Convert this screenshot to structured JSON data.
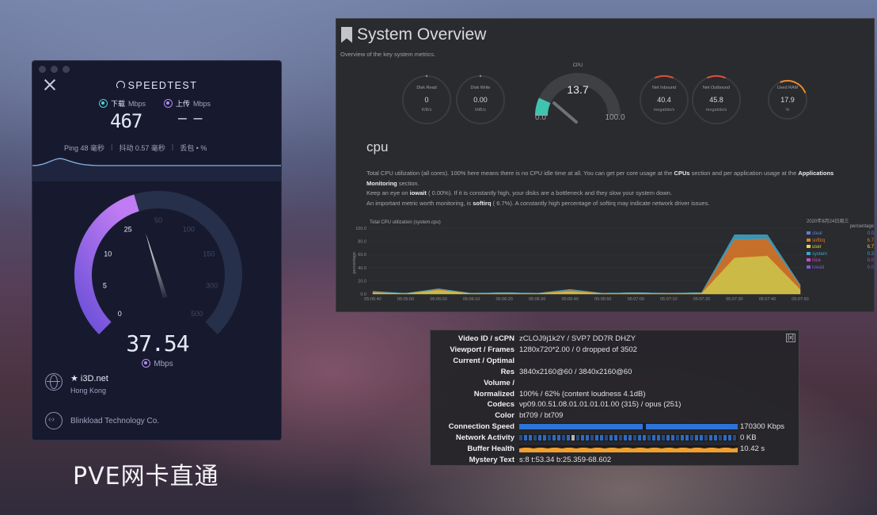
{
  "speedtest": {
    "title": "SPEEDTEST",
    "download": {
      "label": "下载",
      "unit": "Mbps",
      "value": "467"
    },
    "upload": {
      "label": "上传",
      "unit": "Mbps",
      "value": "– –"
    },
    "metrics": {
      "ping": "Ping 48 毫秒",
      "jitter": "抖动 0.57 毫秒",
      "loss": "丢包 • %"
    },
    "gauge": {
      "ticks": [
        "0",
        "5",
        "10",
        "25",
        "50",
        "100",
        "150",
        "300",
        "500"
      ],
      "current_value": "37.54",
      "unit": "Mbps",
      "arc_color": "#9c63e8"
    },
    "host": {
      "name": "★ i3D.net",
      "location": "Hong Kong"
    },
    "isp": "Blinkload Technology Co."
  },
  "caption": "PVE网卡直通",
  "system_overview": {
    "title": "System Overview",
    "subtitle": "Overview of the key system metrics.",
    "gauges": [
      {
        "label": "Disk Read",
        "value": "0",
        "unit": "KiB/s"
      },
      {
        "label": "Disk Write",
        "value": "0.00",
        "unit": "MiB/s"
      },
      {
        "label": "CPU",
        "value": "13.7",
        "min": "0.0",
        "max": "100.0",
        "level": 0.137
      },
      {
        "label": "Net Inbound",
        "value": "40.4",
        "unit": "megabits/s"
      },
      {
        "label": "Net Outbound",
        "value": "45.8",
        "unit": "megabits/s"
      },
      {
        "label": "Used RAM",
        "value": "17.9",
        "unit": "%"
      }
    ],
    "section": "cpu",
    "description": {
      "p1_a": "Total CPU utilization (all cores). 100% here means there is no CPU idle time at all. You can get per core usage at the ",
      "p1_b": "CPUs",
      "p1_c": " section and per application usage at the ",
      "p1_d": "Applications Monitoring",
      "p1_e": " section.",
      "p2_a": "Keep an eye on ",
      "p2_b": "iowait",
      "p2_c": " (        0.00%). If it is constantly high, your disks are a bottleneck and they slow your system down.",
      "p3_a": "An important metric worth monitoring, is ",
      "p3_b": "softirq",
      "p3_c": " (       6.7%). A constantly high percentage of softirq may indicate network driver issues."
    },
    "chart_title": "Total CPU utilization (system.cpu)",
    "chart_timestamp": "2020年8月24日周三",
    "legend_header": "percentage",
    "legend": [
      {
        "name": "steal",
        "value": "0.0",
        "color": "#5b7fd6"
      },
      {
        "name": "softirq",
        "value": "6.7",
        "color": "#e07b2a"
      },
      {
        "name": "user",
        "value": "6.7",
        "color": "#e8d44a"
      },
      {
        "name": "system",
        "value": "0.3",
        "color": "#3fa6c9"
      },
      {
        "name": "nice",
        "value": "0.0",
        "color": "#c94ac2"
      },
      {
        "name": "iowait",
        "value": "0.0",
        "color": "#7a5bd6"
      }
    ]
  },
  "chart_data": {
    "type": "area",
    "title": "Total CPU utilization (system.cpu)",
    "ylabel": "percentage",
    "ylim": [
      0,
      100
    ],
    "y_ticks": [
      "100.0",
      "80.0",
      "60.0",
      "40.0",
      "20.0",
      "0.0"
    ],
    "x": [
      "05:05:40",
      "05:05:50",
      "05:06:00",
      "05:06:10",
      "05:06:20",
      "05:06:30",
      "05:06:40",
      "05:06:50",
      "05:07:00",
      "05:07:10",
      "05:07:20",
      "05:07:30",
      "05:07:40",
      "05:07:50"
    ],
    "series": [
      {
        "name": "user",
        "values": [
          2,
          1,
          6,
          1,
          1,
          1,
          4,
          1,
          1,
          1,
          1,
          55,
          58,
          7
        ]
      },
      {
        "name": "softirq",
        "values": [
          1,
          0,
          1,
          0,
          1,
          0,
          2,
          0,
          1,
          0,
          1,
          28,
          26,
          6
        ]
      },
      {
        "name": "system",
        "values": [
          1,
          0,
          1,
          0,
          0,
          0,
          1,
          0,
          0,
          0,
          0,
          7,
          6,
          1
        ]
      }
    ]
  },
  "stats_for_nerds": {
    "close_label": "[x]",
    "rows": [
      {
        "label": "Video ID / sCPN",
        "value": "zCLOJ9j1k2Y / SVP7 DD7R DHZY"
      },
      {
        "label": "Viewport / Frames",
        "value": "1280x720*2.00 / 0 dropped of 3502"
      },
      {
        "label": "Current / Optimal",
        "value": ""
      },
      {
        "label": "Res",
        "value": "3840x2160@60 / 3840x2160@60"
      },
      {
        "label": "Volume /",
        "value": ""
      },
      {
        "label": "Normalized",
        "value": "100% / 62% (content loudness 4.1dB)"
      },
      {
        "label": "Codecs",
        "value": "vp09.00.51.08.01.01.01.01.00 (315) / opus (251)"
      },
      {
        "label": "Color",
        "value": "bt709 / bt709"
      },
      {
        "label": "Connection Speed",
        "value": "170300 Kbps",
        "bar_color": "#2e74d6"
      },
      {
        "label": "Network Activity",
        "value": "0 KB",
        "bar_color": "#2e74d6"
      },
      {
        "label": "Buffer Health",
        "value": "10.42 s",
        "bar_color": "#f0a030"
      },
      {
        "label": "Mystery Text",
        "value": "s:8 t:53.34 b:25.359-68.602"
      }
    ]
  }
}
